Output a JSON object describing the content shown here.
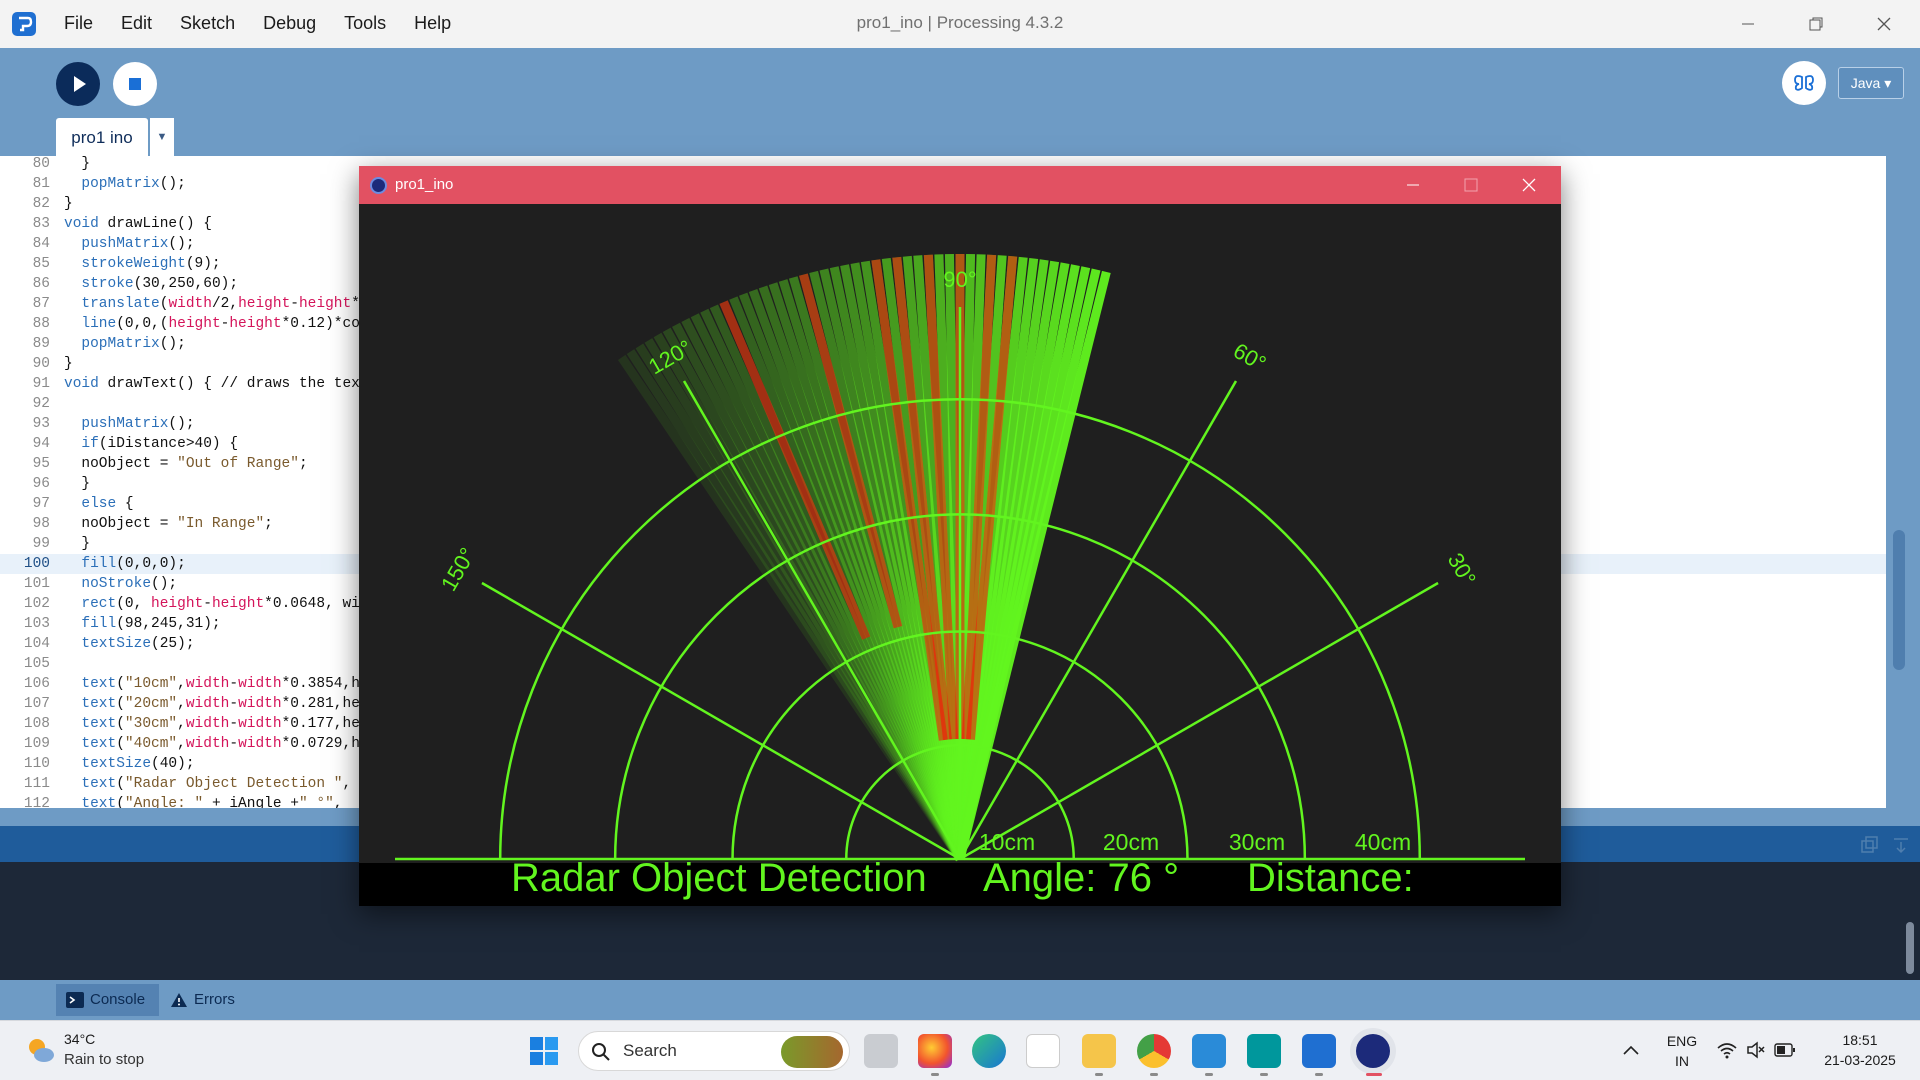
{
  "window": {
    "title": "pro1_ino | Processing 4.3.2"
  },
  "menu": [
    "File",
    "Edit",
    "Sketch",
    "Debug",
    "Tools",
    "Help"
  ],
  "toolbar": {
    "mode_label": "Java ▾"
  },
  "tabs": [
    {
      "label": "pro1 ino"
    }
  ],
  "editor": {
    "highlight_line": 100,
    "lines": [
      {
        "n": "80",
        "t": "  }"
      },
      {
        "n": "81",
        "t": "  popMatrix();"
      },
      {
        "n": "82",
        "t": "}"
      },
      {
        "n": "83",
        "t": "void drawLine() {"
      },
      {
        "n": "84",
        "t": "  pushMatrix();"
      },
      {
        "n": "85",
        "t": "  strokeWeight(9);"
      },
      {
        "n": "86",
        "t": "  stroke(30,250,60);"
      },
      {
        "n": "87",
        "t": "  translate(width/2,height-height*"
      },
      {
        "n": "88",
        "t": "  line(0,0,(height-height*0.12)*co"
      },
      {
        "n": "89",
        "t": "  popMatrix();"
      },
      {
        "n": "90",
        "t": "}"
      },
      {
        "n": "91",
        "t": "void drawText() { // draws the tex"
      },
      {
        "n": "92",
        "t": ""
      },
      {
        "n": "93",
        "t": "  pushMatrix();"
      },
      {
        "n": "94",
        "t": "  if(iDistance>40) {"
      },
      {
        "n": "95",
        "t": "  noObject = \"Out of Range\";"
      },
      {
        "n": "96",
        "t": "  }"
      },
      {
        "n": "97",
        "t": "  else {"
      },
      {
        "n": "98",
        "t": "  noObject = \"In Range\";"
      },
      {
        "n": "99",
        "t": "  }"
      },
      {
        "n": "100",
        "t": "  fill(0,0,0);"
      },
      {
        "n": "101",
        "t": "  noStroke();"
      },
      {
        "n": "102",
        "t": "  rect(0, height-height*0.0648, wi"
      },
      {
        "n": "103",
        "t": "  fill(98,245,31);"
      },
      {
        "n": "104",
        "t": "  textSize(25);"
      },
      {
        "n": "105",
        "t": ""
      },
      {
        "n": "106",
        "t": "  text(\"10cm\",width-width*0.3854,h"
      },
      {
        "n": "107",
        "t": "  text(\"20cm\",width-width*0.281,he"
      },
      {
        "n": "108",
        "t": "  text(\"30cm\",width-width*0.177,he"
      },
      {
        "n": "109",
        "t": "  text(\"40cm\",width-width*0.0729,h"
      },
      {
        "n": "110",
        "t": "  textSize(40);"
      },
      {
        "n": "111",
        "t": "  text(\"Radar Object Detection \", "
      },
      {
        "n": "112",
        "t": "  text(\"Angle: \" + iAngle +\" °\", "
      }
    ]
  },
  "console_tabs": [
    {
      "label": "Console"
    },
    {
      "label": "Errors"
    }
  ],
  "sketch": {
    "title": "pro1_ino",
    "angle_labels": [
      "30°",
      "60°",
      "90°",
      "120°",
      "150°"
    ],
    "range_labels": [
      "10cm",
      "20cm",
      "30cm",
      "40cm"
    ],
    "hud": {
      "title": "Radar Object Detection",
      "angle": "Angle: 76 °",
      "distance": "Distance:"
    },
    "sweep_angle_deg": 76,
    "colors": {
      "green": "#62f51f",
      "red": "#ff0a0a",
      "background": "#1f1f1f"
    }
  },
  "taskbar": {
    "weather": {
      "temp": "34°C",
      "desc": "Rain to stop"
    },
    "search": "Search",
    "lang": {
      "top": "ENG",
      "bottom": "IN"
    },
    "time": "18:51",
    "date": "21-03-2025"
  }
}
